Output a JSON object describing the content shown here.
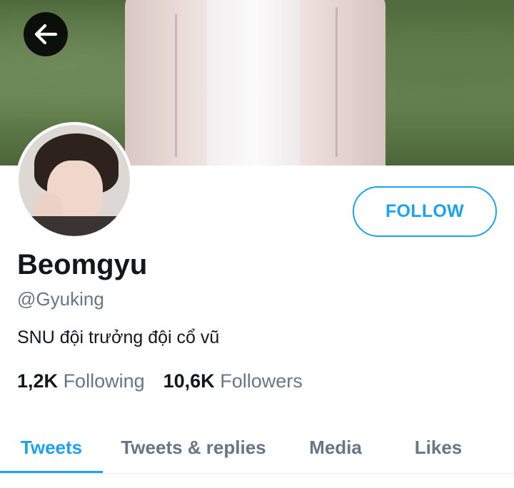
{
  "profile": {
    "name": "Beomgyu",
    "handle": "@Gyuking",
    "bio": "SNU đội trưởng đội cổ vũ"
  },
  "actions": {
    "follow_label": "FOLLOW"
  },
  "stats": {
    "following_count": "1,2K",
    "following_label": "Following",
    "followers_count": "10,6K",
    "followers_label": "Followers"
  },
  "tabs": [
    {
      "label": "Tweets",
      "active": true
    },
    {
      "label": "Tweets & replies",
      "active": false
    },
    {
      "label": "Media",
      "active": false
    },
    {
      "label": "Likes",
      "active": false
    }
  ],
  "icons": {
    "back": "arrow-left-icon"
  },
  "colors": {
    "accent": "#1da1f2",
    "text_primary": "#14171a",
    "text_secondary": "#657786"
  }
}
